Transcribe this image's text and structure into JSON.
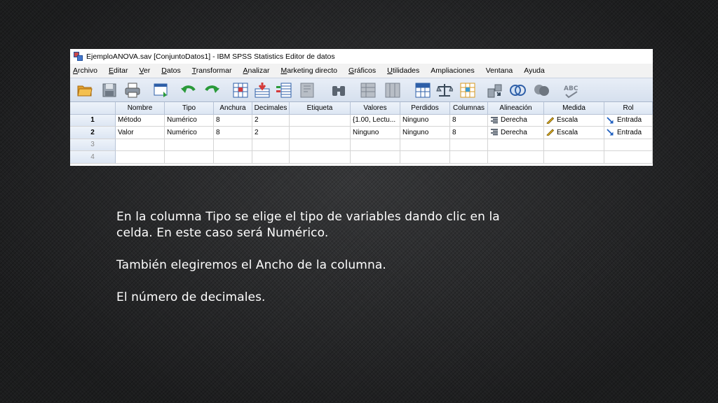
{
  "window": {
    "title": "EjemploANOVA.sav [ConjuntoDatos1] - IBM SPSS Statistics Editor de datos"
  },
  "menu": [
    {
      "underline": "A",
      "rest": "rchivo"
    },
    {
      "underline": "E",
      "rest": "ditar"
    },
    {
      "underline": "V",
      "rest": "er"
    },
    {
      "underline": "D",
      "rest": "atos"
    },
    {
      "underline": "T",
      "rest": "ransformar"
    },
    {
      "underline": "A",
      "rest": "nalizar"
    },
    {
      "underline": "M",
      "rest": "arketing directo"
    },
    {
      "underline": "G",
      "rest": "ráficos"
    },
    {
      "underline": "U",
      "rest": "tilidades"
    },
    {
      "underline": "",
      "rest": "Ampliaciones"
    },
    {
      "underline": "",
      "rest": "Ventana"
    },
    {
      "underline": "",
      "rest": "Ayuda"
    }
  ],
  "toolbar_icons": [
    "open-folder-icon",
    "save-icon",
    "print-icon",
    "dialog-recall-icon",
    "undo-icon",
    "redo-icon",
    "goto-case-icon",
    "goto-variable-icon",
    "variables-icon",
    "run-descriptives-icon",
    "find-icon",
    "insert-cases-icon",
    "insert-variable-icon",
    "split-file-icon",
    "weight-cases-icon",
    "select-cases-icon",
    "value-labels-icon",
    "use-sets-icon",
    "show-all-variables-icon",
    "spell-check-icon"
  ],
  "grid": {
    "headers": [
      "",
      "Nombre",
      "Tipo",
      "Anchura",
      "Decimales",
      "Etiqueta",
      "Valores",
      "Perdidos",
      "Columnas",
      "Alineación",
      "Medida",
      "Rol"
    ],
    "rows": [
      {
        "num": "1",
        "nombre": "Método",
        "tipo": "Numérico",
        "anchura": "8",
        "decimales": "2",
        "etiqueta": "",
        "valores": "{1.00, Lectu...",
        "perdidos": "Ninguno",
        "columnas": "8",
        "alineacion": "Derecha",
        "medida": "Escala",
        "rol": "Entrada"
      },
      {
        "num": "2",
        "nombre": "Valor",
        "tipo": "Numérico",
        "anchura": "8",
        "decimales": "2",
        "etiqueta": "",
        "valores": "Ninguno",
        "perdidos": "Ninguno",
        "columnas": "8",
        "alineacion": "Derecha",
        "medida": "Escala",
        "rol": "Entrada"
      },
      {
        "num": "3"
      },
      {
        "num": "4"
      }
    ]
  },
  "caption": {
    "line1": "En la columna Tipo se elige el tipo de variables dando clic en la",
    "line2": "celda. En este caso será Numérico.",
    "line3": "También elegiremos el Ancho de la columna.",
    "line4": "El número de decimales."
  },
  "colors": {
    "background": "#2b2c2e",
    "text": "#ffffff",
    "grid_header": "#dde6f3",
    "toolbar": "#d6e0ee"
  }
}
